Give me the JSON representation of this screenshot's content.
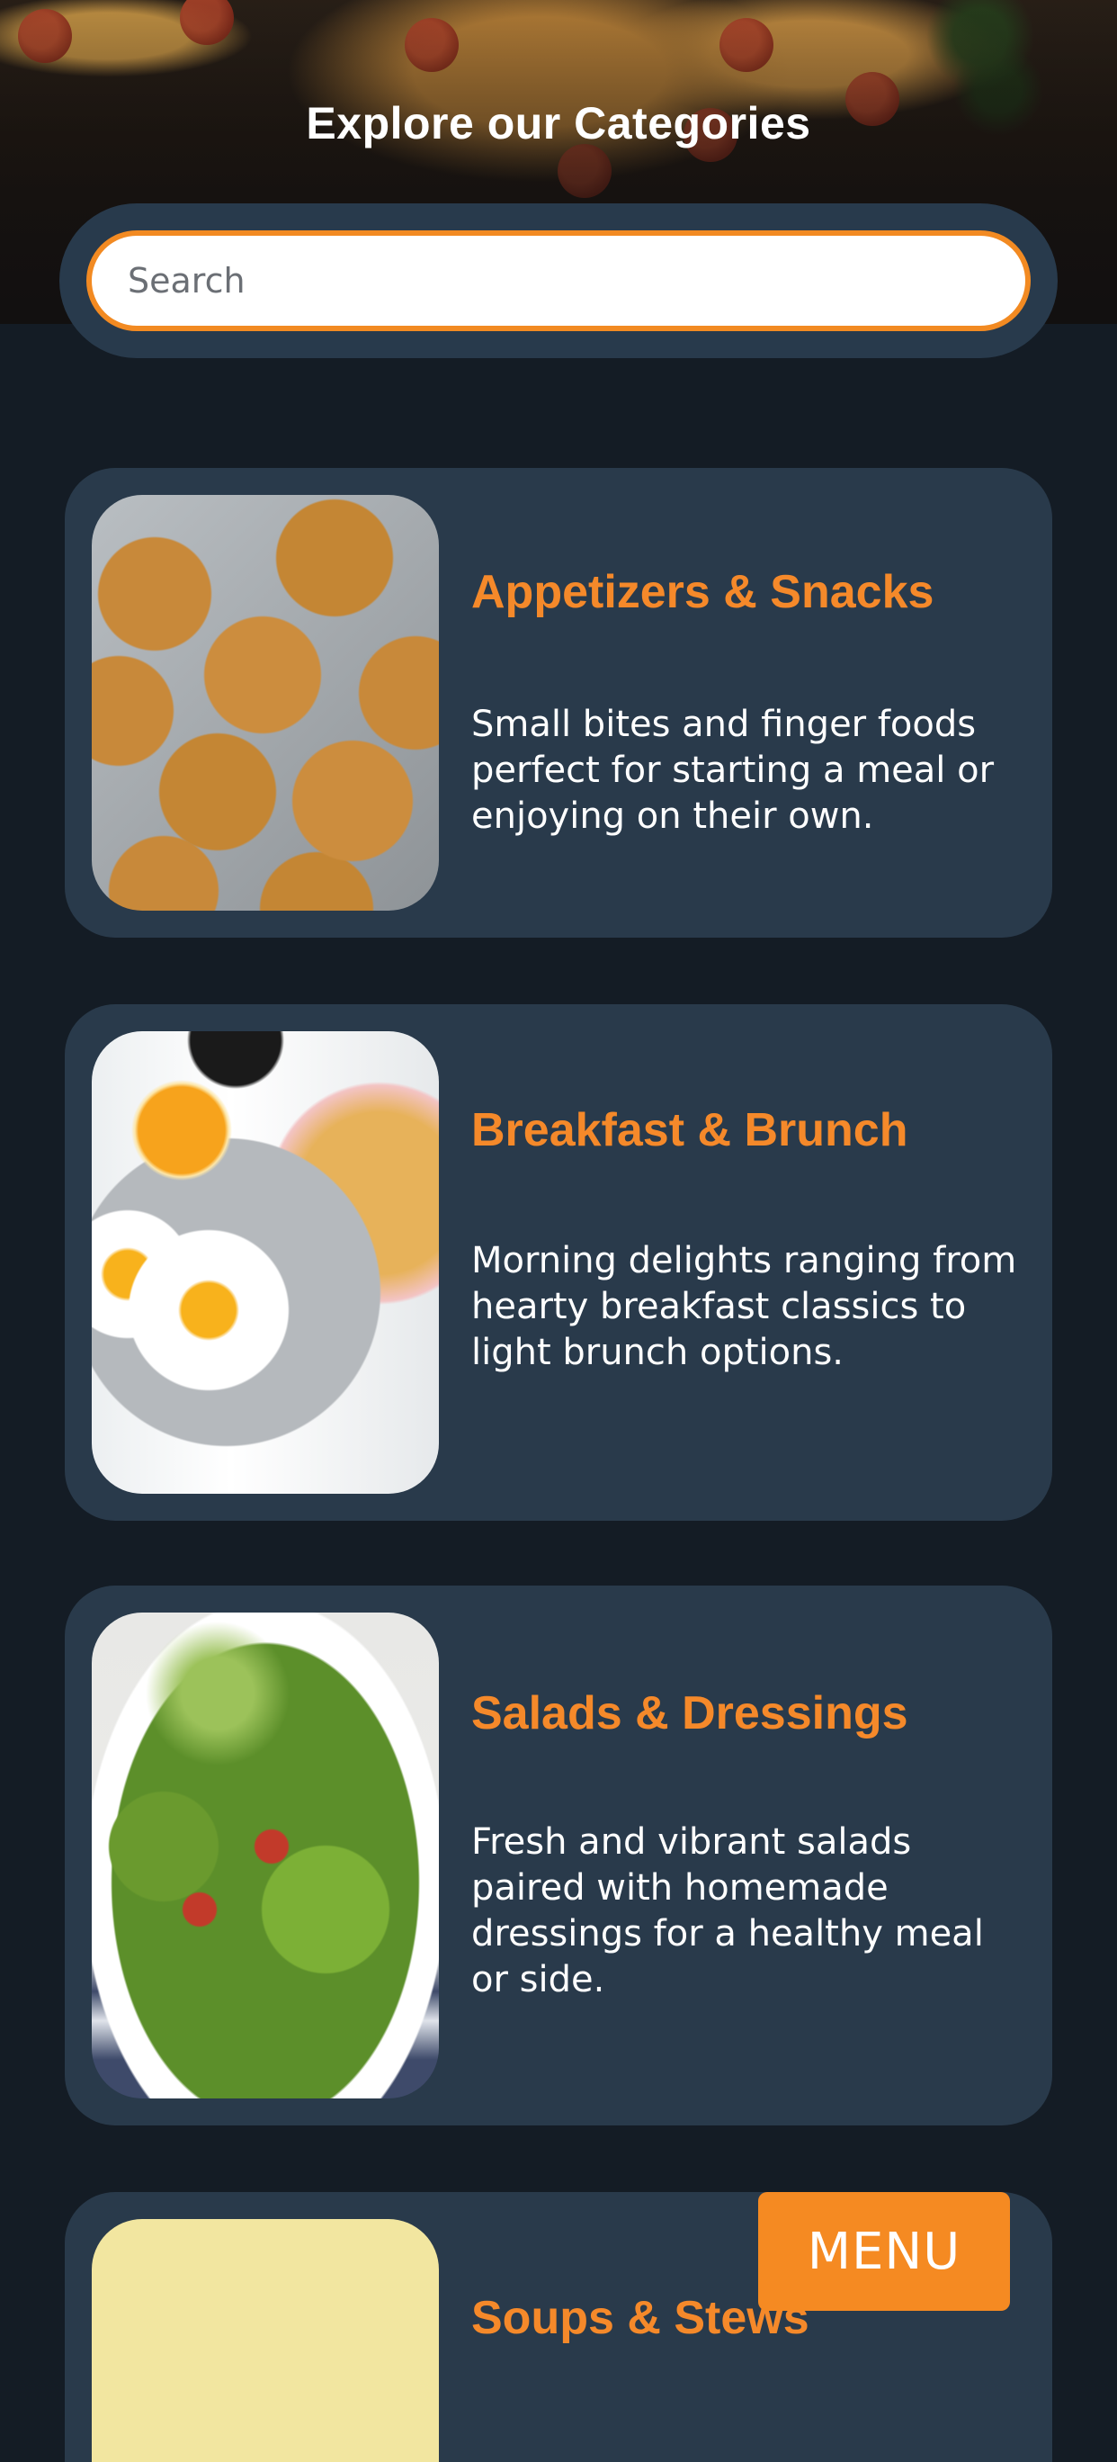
{
  "header": {
    "title": "Explore our Categories"
  },
  "search": {
    "placeholder": "Search",
    "value": ""
  },
  "categories": [
    {
      "title": "Appetizers & Snacks",
      "description": "Small bites and finger foods perfect for starting a meal or enjoying on their own."
    },
    {
      "title": "Breakfast & Brunch",
      "description": "Morning delights ranging from hearty breakfast classics to light brunch options."
    },
    {
      "title": "Salads & Dressings",
      "description": "Fresh and vibrant salads paired with homemade dressings for a healthy meal or side."
    },
    {
      "title": "Soups & Stews",
      "description": ""
    }
  ],
  "menu_button": {
    "label": "MENU"
  },
  "colors": {
    "accent": "#f58a22",
    "background": "#141c25",
    "card": "#293a4b"
  }
}
